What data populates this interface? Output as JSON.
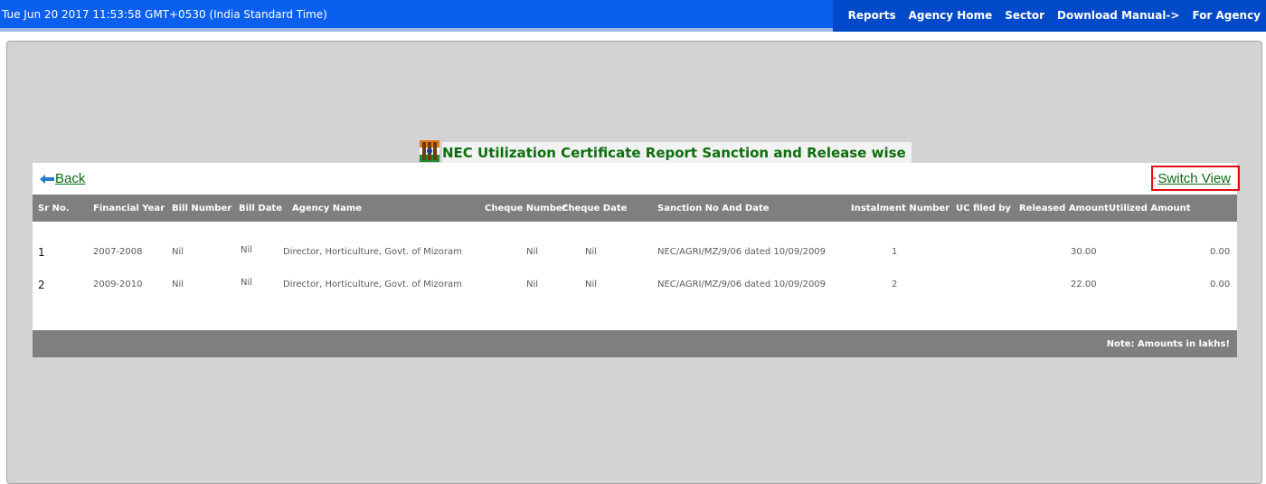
{
  "header": {
    "datetime": "Tue Jun 20 2017 11:53:58 GMT+0530 (India Standard Time)",
    "nav": [
      "Reports",
      "Agency Home",
      "Sector",
      "Download Manual->",
      "For Agency"
    ],
    "color": "#0a5fef"
  },
  "page": {
    "title": "NEC Utilization Certificate Report Sanction and Release wise",
    "back_label": "Back",
    "switch_view_label": "Switch View",
    "title_color": "#0d6e0d"
  },
  "table": {
    "headers": {
      "sr": "Sr No.",
      "financial_year": "Financial Year",
      "bill_number": "Bill Number",
      "bill_date": "Bill Date",
      "agency_name": "Agency Name",
      "cheque_number": "Cheque Number",
      "cheque_date": "Cheque Date",
      "sanction": "Sanction No And Date",
      "instalment": "Instalment Number",
      "uc_filed_by": "UC filed by",
      "released": "Released Amount",
      "utilized": "Utilized Amount"
    },
    "rows": [
      {
        "sr": "1",
        "financial_year": "2007-2008",
        "bill_number": "Nil",
        "bill_date": "Nil",
        "agency_name": "Director, Horticulture, Govt. of Mizoram",
        "cheque_number": "Nil",
        "cheque_date": "Nil",
        "sanction": "NEC/AGRI/MZ/9/06 dated 10/09/2009",
        "instalment": "1",
        "uc_filed_by": "",
        "released": "30.00",
        "utilized": "0.00"
      },
      {
        "sr": "2",
        "financial_year": "2009-2010",
        "bill_number": "Nil",
        "bill_date": "Nil",
        "agency_name": "Director, Horticulture, Govt. of Mizoram",
        "cheque_number": "Nil",
        "cheque_date": "Nil",
        "sanction": "NEC/AGRI/MZ/9/06 dated 10/09/2009",
        "instalment": "2",
        "uc_filed_by": "",
        "released": "22.00",
        "utilized": "0.00"
      }
    ],
    "footer_note": "Note: Amounts in lakhs!"
  }
}
